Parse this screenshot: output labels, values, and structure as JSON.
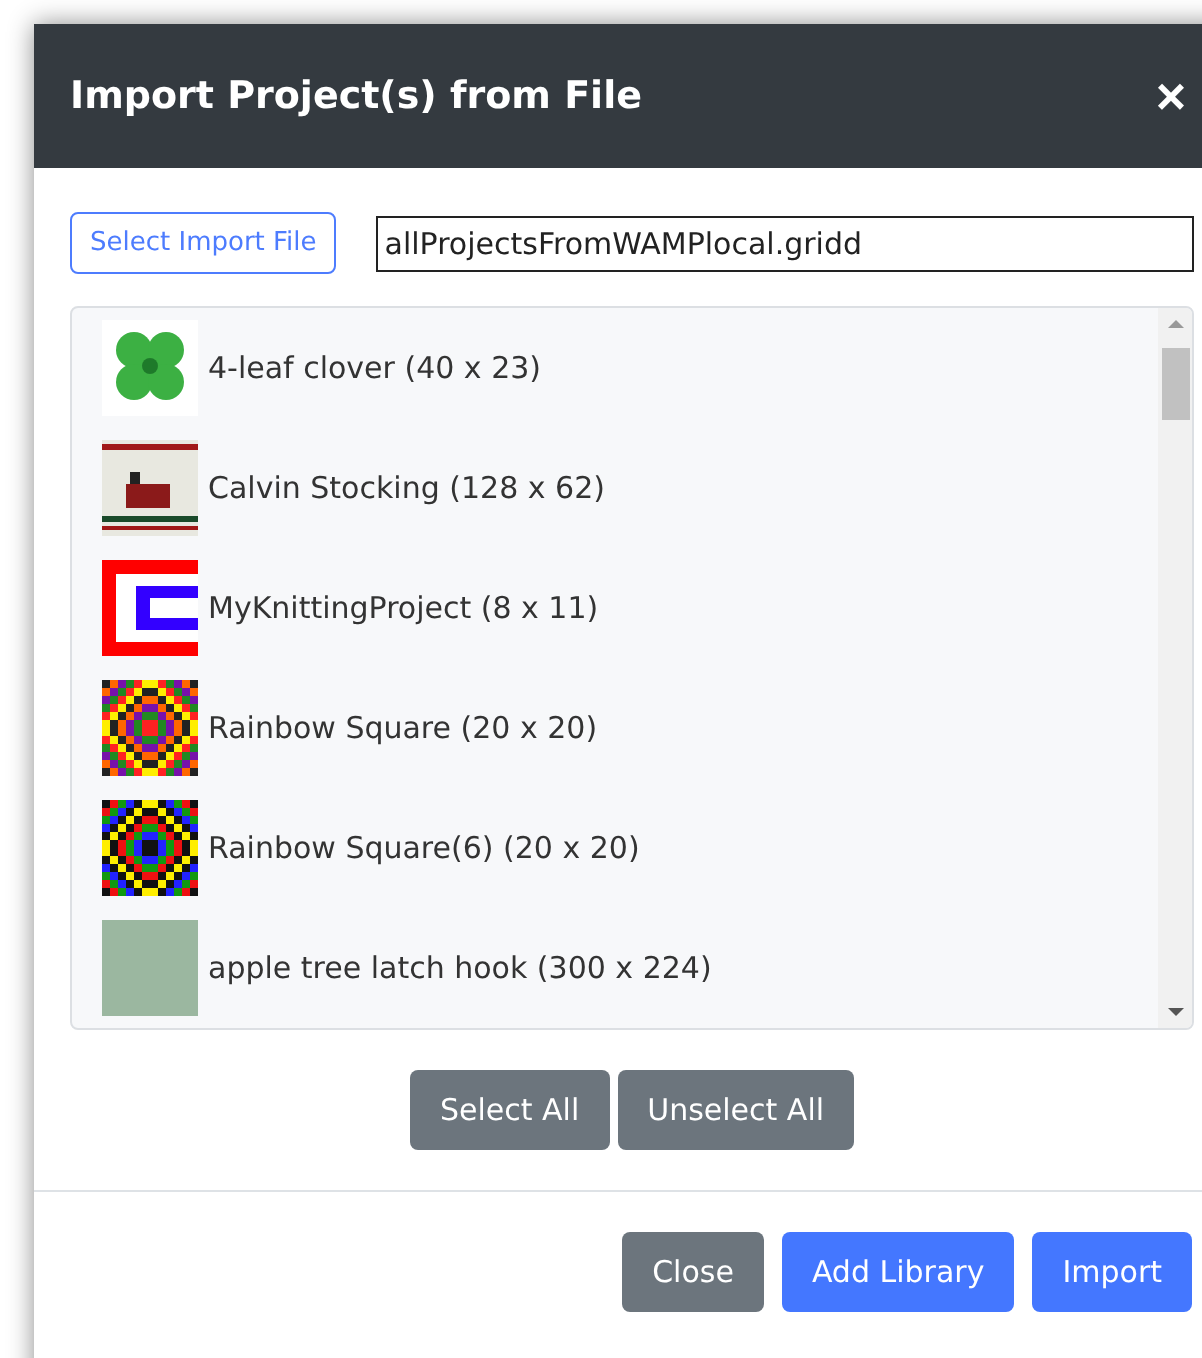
{
  "dialog": {
    "title": "Import Project(s) from File",
    "close_glyph": "×"
  },
  "file_picker": {
    "button": "Select Import File",
    "value": "allProjectsFromWAMPlocal.gridd"
  },
  "projects": [
    {
      "kind": "clover",
      "label": "4-leaf clover (40 x 23)"
    },
    {
      "kind": "stocking",
      "label": "Calvin Stocking (128 x 62)"
    },
    {
      "kind": "frame",
      "label": "MyKnittingProject (8 x 11)"
    },
    {
      "kind": "rainbow",
      "label": "Rainbow Square (20 x 20)"
    },
    {
      "kind": "rainbow-dark",
      "label": "Rainbow Square(6) (20 x 20)"
    },
    {
      "kind": "photo",
      "label": "apple tree latch hook (300 x 224)"
    }
  ],
  "selection_buttons": [
    "Select All",
    "Unselect All"
  ],
  "footer_buttons": [
    {
      "kind": "secondary",
      "label": "Close"
    },
    {
      "kind": "primary",
      "label": "Add Library"
    },
    {
      "kind": "primary",
      "label": "Import"
    }
  ]
}
